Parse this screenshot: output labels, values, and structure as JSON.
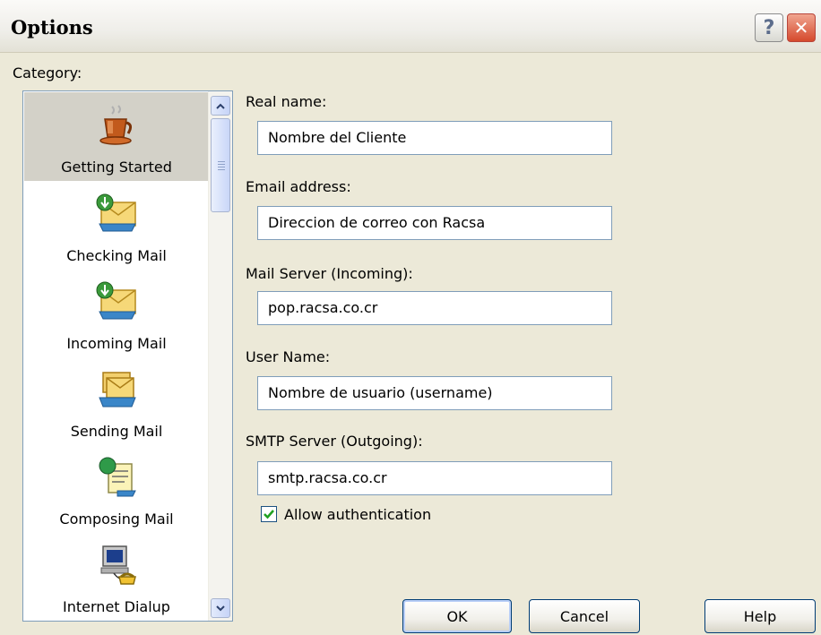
{
  "window": {
    "title": "Options",
    "help_button": "?",
    "close_button": "✕"
  },
  "category": {
    "label": "Category:",
    "items": [
      {
        "label": "Getting Started",
        "icon": "coffee-cup-icon",
        "selected": true
      },
      {
        "label": "Checking Mail",
        "icon": "download-mail-icon",
        "selected": false
      },
      {
        "label": "Incoming Mail",
        "icon": "incoming-mail-icon",
        "selected": false
      },
      {
        "label": "Sending Mail",
        "icon": "outbox-icon",
        "selected": false
      },
      {
        "label": "Composing Mail",
        "icon": "compose-document-icon",
        "selected": false
      },
      {
        "label": "Internet Dialup",
        "icon": "computer-phone-icon",
        "selected": false
      }
    ]
  },
  "form": {
    "real_name": {
      "label": "Real name:",
      "value": "Nombre del Cliente"
    },
    "email": {
      "label": "Email address:",
      "value": "Direccion de correo con Racsa"
    },
    "incoming": {
      "label": "Mail Server (Incoming):",
      "value": "pop.racsa.co.cr"
    },
    "username": {
      "label": "User Name:",
      "value": "Nombre de usuario (username)"
    },
    "smtp": {
      "label": "SMTP Server (Outgoing):",
      "value": "smtp.racsa.co.cr"
    },
    "allow_auth": {
      "label": "Allow authentication",
      "checked": true
    }
  },
  "buttons": {
    "ok": "OK",
    "cancel": "Cancel",
    "help": "Help"
  },
  "colors": {
    "selection": "#d3d1c8",
    "checkmark": "#21a121",
    "dialog_bg": "#ece9d8",
    "border": "#7f9db9"
  }
}
